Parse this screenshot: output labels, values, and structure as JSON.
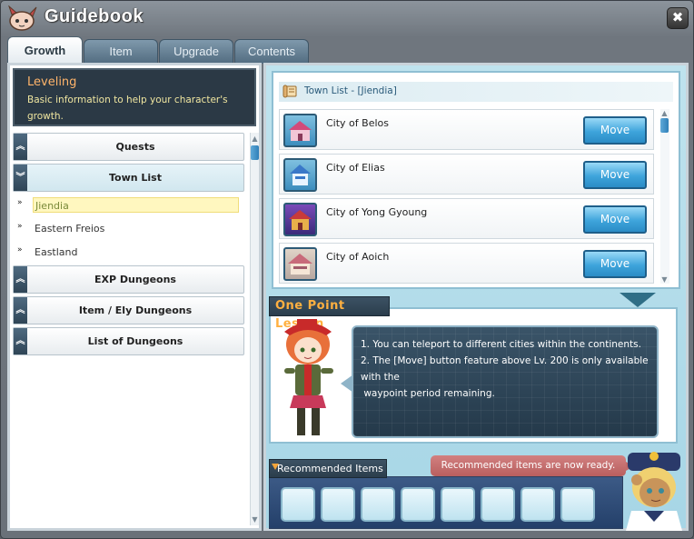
{
  "window": {
    "title": "Guidebook",
    "close_label": "✖"
  },
  "tabs": [
    {
      "label": "Growth",
      "active": true
    },
    {
      "label": "Item",
      "active": false
    },
    {
      "label": "Upgrade",
      "active": false
    },
    {
      "label": "Contents",
      "active": false
    }
  ],
  "info": {
    "title": "Leveling",
    "description": "Basic information to help your character's growth."
  },
  "menu": {
    "quests": "Quests",
    "town_list": "Town List",
    "sub_items": [
      "Jiendia",
      "Eastern Freios",
      "Eastland"
    ],
    "exp_dungeons": "EXP Dungeons",
    "item_ely_dungeons": "Item / Ely Dungeons",
    "list_of_dungeons": "List of Dungeons",
    "chevron_up": "︽",
    "chevron_down": "︾"
  },
  "town_panel": {
    "header": "Town List - [Jiendia]",
    "towns": [
      {
        "name": "City of Belos",
        "button": "Move"
      },
      {
        "name": "City of Elias",
        "button": "Move"
      },
      {
        "name": "City of Yong Gyoung",
        "button": "Move"
      },
      {
        "name": "City of Aoich",
        "button": "Move"
      }
    ]
  },
  "lesson": {
    "title": "One Point Lesson",
    "line1": "1. You can teleport to different cities within the continents.",
    "line2": "2. The [Move] button feature above Lv. 200 is only available with the",
    "line3": " waypoint period remaining."
  },
  "recommended": {
    "title": "Recommended Items",
    "notice": "Recommended items are now ready.",
    "slot_count": 8
  },
  "colors": {
    "accent": "#3ea4db",
    "lesson_title": "#ffb040",
    "info_title": "#ffb46a",
    "notice_bg": "#c06a6a"
  },
  "icons": {
    "window": "bunny-character-icon",
    "close": "close-icon",
    "town_header": "scroll-icon"
  }
}
